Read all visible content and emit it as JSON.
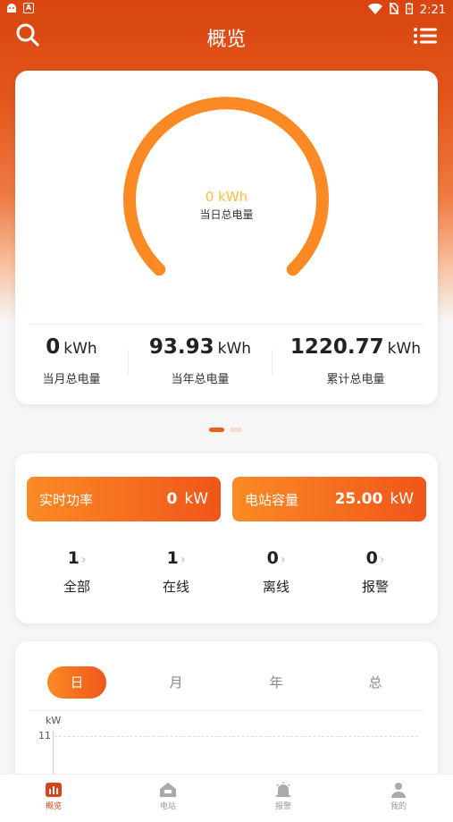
{
  "status_bar": {
    "time": "2:21",
    "notif_icon_a": "A"
  },
  "header": {
    "title": "概览"
  },
  "energy": {
    "gauge_value": "0 kWh",
    "gauge_label": "当日总电量",
    "gauge_fraction": 0,
    "stats": [
      {
        "value": "0",
        "unit": "kWh",
        "label": "当月总电量"
      },
      {
        "value": "93.93",
        "unit": "kWh",
        "label": "当年总电量"
      },
      {
        "value": "1220.77",
        "unit": "kWh",
        "label": "累计总电量"
      }
    ]
  },
  "power": {
    "realtime": {
      "label": "实时功率",
      "value": "0",
      "unit": "kW"
    },
    "capacity": {
      "label": "电站容量",
      "value": "25.00",
      "unit": "kW"
    },
    "counts": [
      {
        "value": "1",
        "label": "全部"
      },
      {
        "value": "1",
        "label": "在线"
      },
      {
        "value": "0",
        "label": "离线"
      },
      {
        "value": "0",
        "label": "报警"
      }
    ]
  },
  "chart": {
    "tabs": [
      "日",
      "月",
      "年",
      "总"
    ],
    "active_tab": "日",
    "ylabel": "kW",
    "ytick": "11"
  },
  "chart_data": {
    "type": "line",
    "ylabel": "kW",
    "yticks": [
      11
    ],
    "series": []
  },
  "bottom_nav": {
    "items": [
      {
        "label": "概览",
        "icon": "bar-chart-icon",
        "active": true
      },
      {
        "label": "电站",
        "icon": "house-icon",
        "active": false
      },
      {
        "label": "报警",
        "icon": "alarm-icon",
        "active": false
      },
      {
        "label": "我的",
        "icon": "user-icon",
        "active": false
      }
    ]
  },
  "colors": {
    "accent": "#e8601c",
    "gauge": "#fb8a25",
    "gauge_value": "#f5c13c",
    "active_nav": "#d8431a"
  }
}
